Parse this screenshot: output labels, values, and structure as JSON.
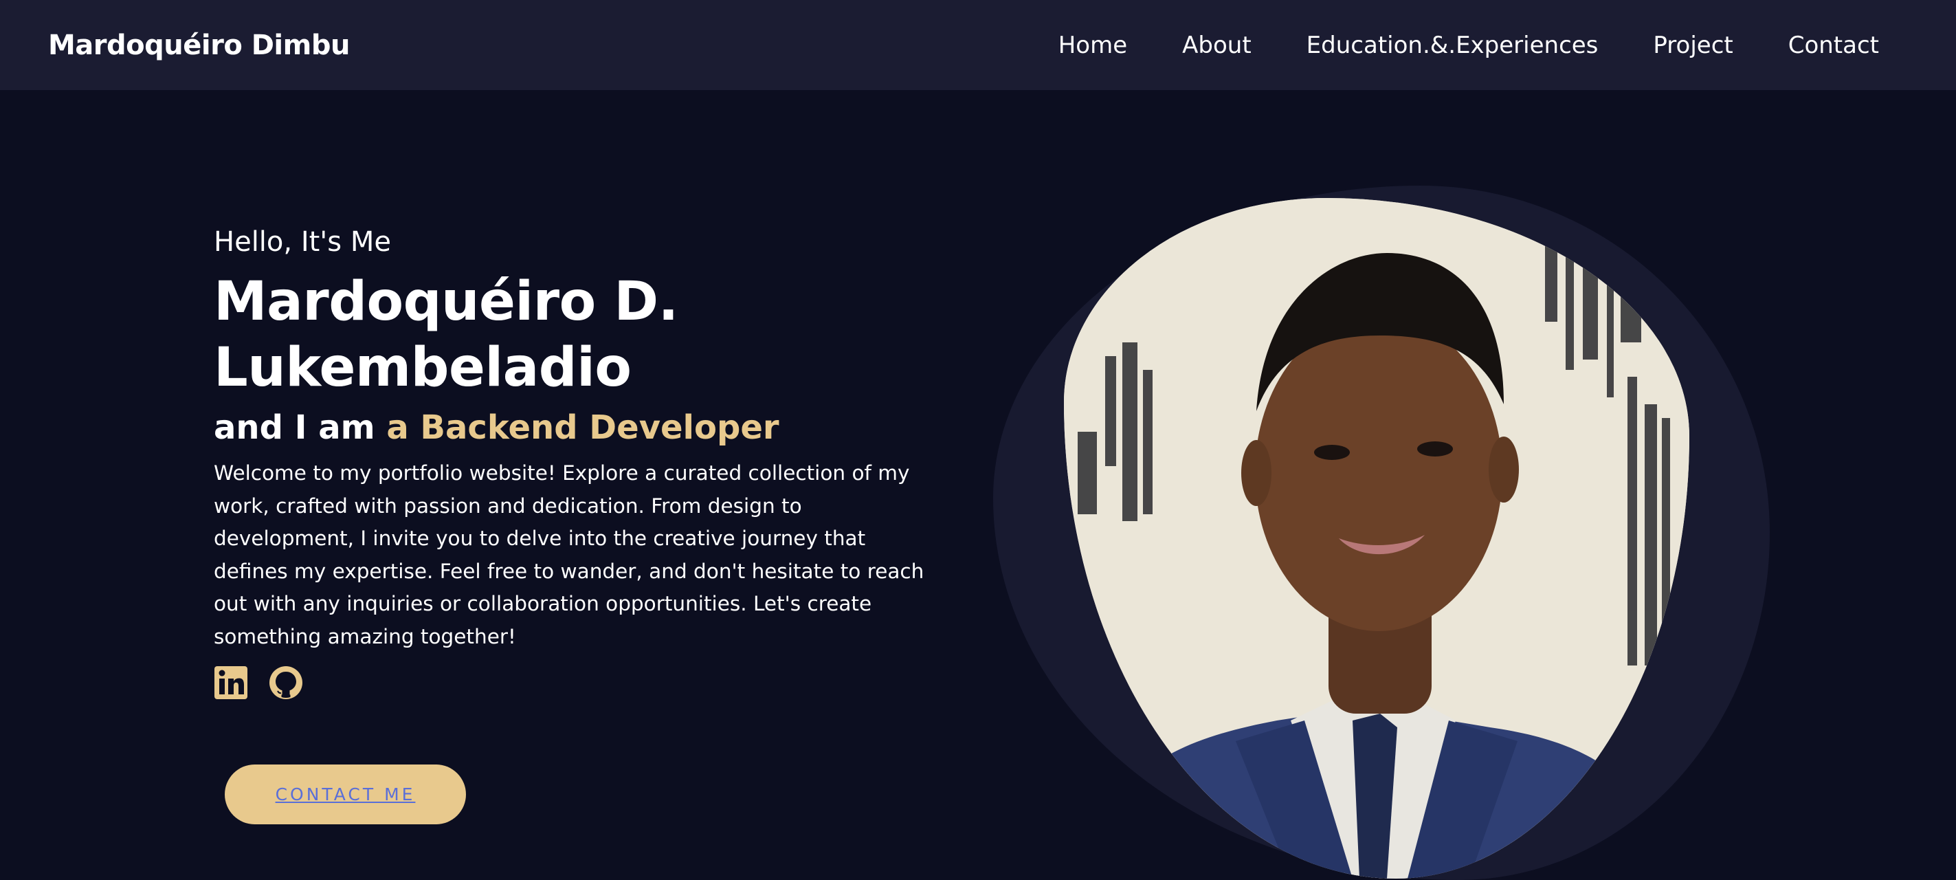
{
  "header": {
    "brand": "Mardoquéiro Dimbu",
    "nav": [
      {
        "label": "Home"
      },
      {
        "label": "About"
      },
      {
        "label": "Education.&.Experiences"
      },
      {
        "label": "Project"
      },
      {
        "label": "Contact"
      }
    ]
  },
  "hero": {
    "greeting": "Hello, It's Me",
    "name_line1": "Mardoquéiro D.",
    "name_line2": "Lukembeladio",
    "role_prefix": "and I am ",
    "role_highlight": "a Backend Developer",
    "intro": "Welcome to my portfolio website! Explore a curated collection of my work, crafted with passion and dedication. From design to development, I invite you to delve into the creative journey that defines my expertise. Feel free to wander, and don't hesitate to reach out with any inquiries or collaboration opportunities. Let's create something amazing together!",
    "contact_button": "CONTACT ME",
    "socials": [
      {
        "icon": "linkedin-icon"
      },
      {
        "icon": "github-icon"
      }
    ]
  },
  "colors": {
    "background": "#0c0e20",
    "navbar": "#1b1c32",
    "accent": "#e8c98d",
    "button_text": "#5a6fd8",
    "blob": "#181a30"
  }
}
